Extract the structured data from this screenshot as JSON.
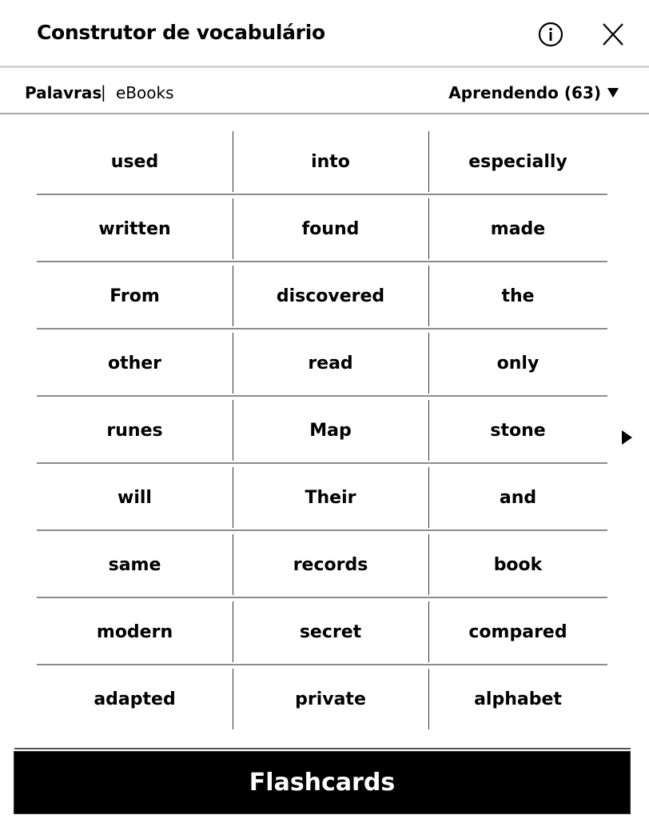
{
  "header": {
    "title": "Construtor de vocabulário",
    "info_icon": "info-circle-icon",
    "close_icon": "close-x-icon"
  },
  "tabs": {
    "words": "Palavras",
    "separator": "|",
    "ebooks": "eBooks"
  },
  "filter": {
    "label": "Aprendendo (63)",
    "icon": "dropdown-triangle-icon"
  },
  "words": [
    [
      "used",
      "into",
      "especially"
    ],
    [
      "written",
      "found",
      "made"
    ],
    [
      "From",
      "discovered",
      "the"
    ],
    [
      "other",
      "read",
      "only"
    ],
    [
      "runes",
      "Map",
      "stone"
    ],
    [
      "will",
      "Their",
      "and"
    ],
    [
      "same",
      "records",
      "book"
    ],
    [
      "modern",
      "secret",
      "compared"
    ],
    [
      "adapted",
      "private",
      "alphabet"
    ]
  ],
  "pagination": {
    "next_icon": "next-page-triangle-icon"
  },
  "footer": {
    "flashcards_label": "Flashcards"
  }
}
